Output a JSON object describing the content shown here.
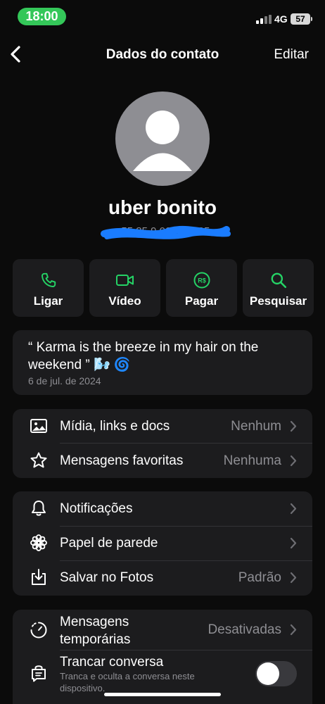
{
  "status_bar": {
    "time": "18:00",
    "network": "4G",
    "battery": "57"
  },
  "nav": {
    "title": "Dados do contato",
    "edit_label": "Editar"
  },
  "profile": {
    "name": "uber bonito",
    "phone": "+55 85 9 0000-0125"
  },
  "actions": [
    {
      "label": "Ligar",
      "icon": "phone-icon"
    },
    {
      "label": "Vídeo",
      "icon": "video-icon"
    },
    {
      "label": "Pagar",
      "icon": "pay-icon",
      "glyph": "R$"
    },
    {
      "label": "Pesquisar",
      "icon": "search-icon"
    }
  ],
  "about": {
    "text": "“ Karma is the breeze in my hair on the weekend ” 🌬️ 🌀",
    "date": "6 de jul. de 2024"
  },
  "media_section": [
    {
      "label": "Mídia, links e docs",
      "value": "Nenhum",
      "icon": "photo-icon"
    },
    {
      "label": "Mensagens favoritas",
      "value": "Nenhuma",
      "icon": "star-icon"
    }
  ],
  "settings_section": [
    {
      "label": "Notificações",
      "icon": "bell-icon"
    },
    {
      "label": "Papel de parede",
      "icon": "flower-icon"
    },
    {
      "label": "Salvar no Fotos",
      "value": "Padrão",
      "icon": "download-icon"
    }
  ],
  "privacy_section": {
    "disappearing": {
      "label": "Mensagens temporárias",
      "value": "Desativadas",
      "icon": "timer-icon"
    },
    "lock_chat": {
      "label": "Trancar conversa",
      "description": "Tranca e oculta a conversa neste dispositivo.",
      "icon": "lock-chat-icon",
      "enabled": false
    }
  },
  "colors": {
    "accent": "#25d366",
    "background": "#0b0b0b",
    "card": "#1c1c1e",
    "secondary_text": "#8e8e93",
    "status_pill": "#34c759"
  }
}
